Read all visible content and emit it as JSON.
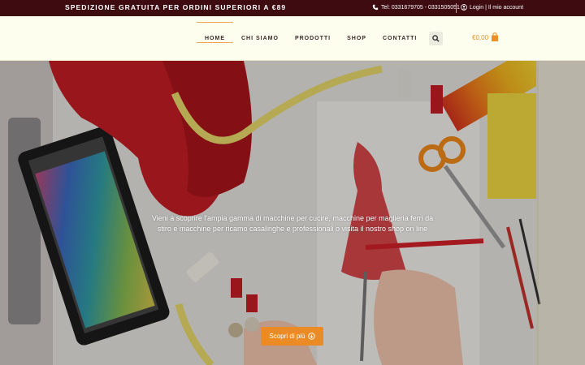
{
  "topbar": {
    "promo": "SPEDIZIONE GRATUITA PER ORDINI SUPERIORI A €89",
    "phone": "Tel: 0331679705 - 0331505051",
    "account": "Login | Il mio account"
  },
  "nav": {
    "items": [
      {
        "label": "HOME"
      },
      {
        "label": "CHI SIAMO"
      },
      {
        "label": "PRODOTTI"
      },
      {
        "label": "SHOP"
      },
      {
        "label": "CONTATTI"
      }
    ]
  },
  "cart": {
    "total": "€0,00"
  },
  "hero": {
    "text": "Vieni a scoprire l'ampia gamma di macchine per cucire, macchine per maglieria ferri da stiro e macchine per ricamo casalinghe e professionali o visita il nostro shop on line",
    "cta_label": "Scopri di più"
  },
  "colors": {
    "topbar": "#3d0b10",
    "header": "#fefeee",
    "accent": "#ea8b25"
  },
  "icons": [
    "phone-icon",
    "user-icon",
    "search-icon",
    "shopping-bag-icon",
    "arrow-down-circle-icon"
  ]
}
